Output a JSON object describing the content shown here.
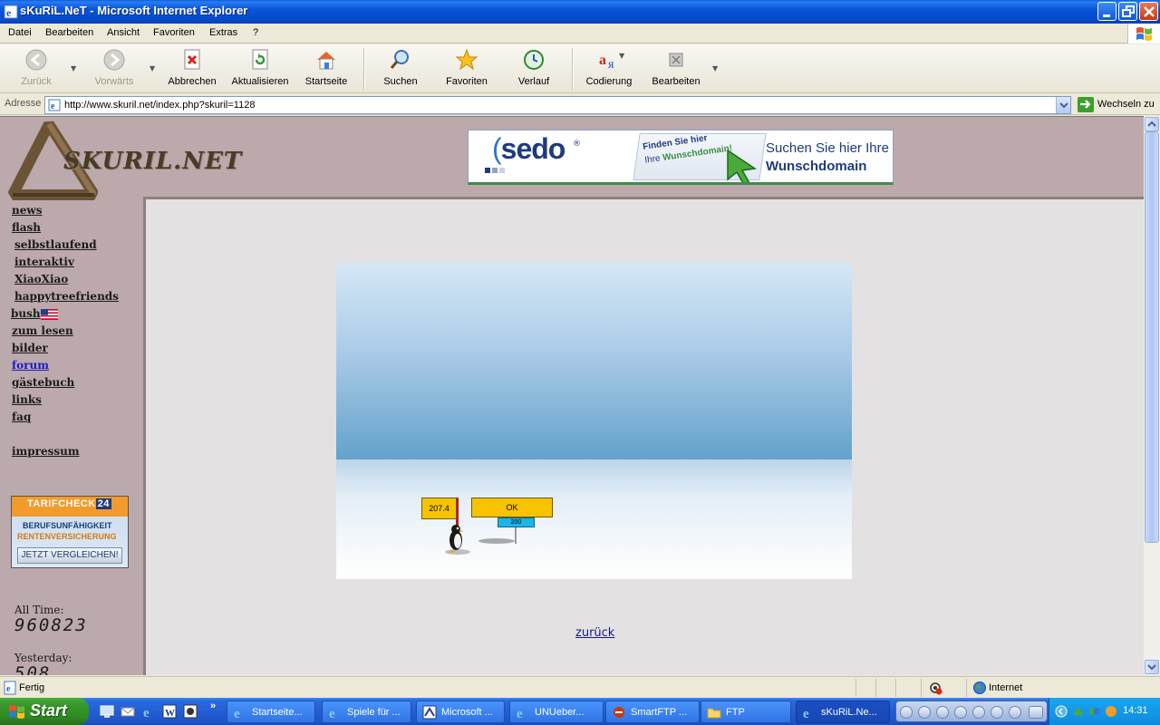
{
  "window": {
    "title": "sKuRiL.NeT - Microsoft Internet Explorer"
  },
  "menu": [
    "Datei",
    "Bearbeiten",
    "Ansicht",
    "Favoriten",
    "Extras",
    "?"
  ],
  "toolbar": {
    "back": "Zurück",
    "forward": "Vorwärts",
    "stop": "Abbrechen",
    "refresh": "Aktualisieren",
    "home": "Startseite",
    "search": "Suchen",
    "favorites": "Favoriten",
    "history": "Verlauf",
    "encoding": "Codierung",
    "edit": "Bearbeiten"
  },
  "address": {
    "label": "Adresse",
    "url": "http://www.skuril.net/index.php?skuril=1128",
    "go": "Wechseln zu"
  },
  "site": {
    "logo": "SKURIL.NET",
    "nav": {
      "news": "news",
      "flash": "flash",
      "selbstlaufend": "selbstlaufend",
      "interaktiv": "interaktiv",
      "xiaoxiao": "XiaoXiao",
      "happytreefriends": "happytreefriends",
      "bush": "bush",
      "zum_lesen": "zum lesen",
      "bilder": "bilder",
      "forum": "forum",
      "gaestebuch": "gästebuch",
      "links": "links",
      "faq": "faq",
      "impressum": "impressum"
    },
    "banner": {
      "brand": "sedo",
      "reg": "®",
      "find_line1": "Finden Sie hier",
      "find_line2_a": "Ihre ",
      "find_line2_b": "Wunschdomain!",
      "cta_line1": "Suchen Sie hier Ihre",
      "cta_line2": "Wunschdomain"
    },
    "ad": {
      "title": "TARIFCHECK",
      "badge": "24",
      "line1": "BERUFSUNFÄHIGKEIT",
      "line2": "RENTENVERSICHERUNG",
      "cta": "JETZT VERGLEICHEN!"
    },
    "stats": {
      "all_time_label": "All Time:",
      "all_time_value": "960823",
      "yesterday_label": "Yesterday:",
      "yesterday_value": "508"
    },
    "game": {
      "distance": "207.4",
      "status": "OK",
      "marker": "200"
    },
    "back_link": "zurück"
  },
  "status": {
    "text": "Fertig",
    "zone": "Internet"
  },
  "taskbar": {
    "start": "Start",
    "tasks": [
      "Startseite...",
      "Spiele für ...",
      "Microsoft ...",
      "UNUeber...",
      "SmartFTP ...",
      "FTP",
      "sKuRiL.Ne..."
    ],
    "clock": "14:31"
  },
  "colors": {
    "accent": "#0A5FE0",
    "site_bg": "#BCA9AB",
    "content_bg": "#E3E1E1"
  }
}
